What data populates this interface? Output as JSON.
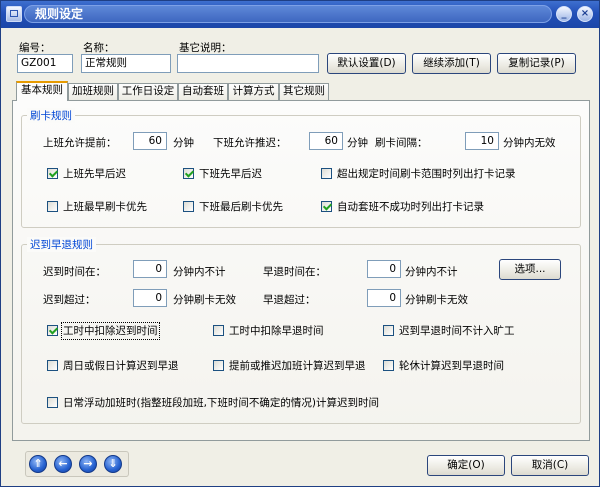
{
  "window": {
    "title": "规则设定"
  },
  "header": {
    "code_label": "编号：",
    "code_value": "GZ001",
    "name_label": "名称：",
    "name_value": "正常规则",
    "desc_label": "基它说明：",
    "desc_value": "",
    "btn_default": "默认设置(D)",
    "btn_add": "继续添加(T)",
    "btn_copy": "复制记录(P)"
  },
  "tabs": [
    "基本规则",
    "加班规则",
    "工作日设定",
    "自动套班",
    "计算方式",
    "其它规则"
  ],
  "active_tab": "基本规则",
  "swipe": {
    "group_title": "刷卡规则",
    "early_label": "上班允许提前：",
    "early_value": "60",
    "early_unit": "分钟",
    "late_label": "下班允许推迟：",
    "late_value": "60",
    "late_unit": "分钟",
    "interval_label": "刷卡间隔：",
    "interval_value": "10",
    "interval_unit": "分钟内无效",
    "checks": [
      {
        "label": "上班先早后迟",
        "checked": true
      },
      {
        "label": "下班先早后迟",
        "checked": true
      },
      {
        "label": "超出规定时间刷卡范围时列出打卡记录",
        "checked": false
      },
      {
        "label": "上班最早刷卡优先",
        "checked": false
      },
      {
        "label": "下班最后刷卡优先",
        "checked": false
      },
      {
        "label": "自动套班不成功时列出打卡记录",
        "checked": true
      }
    ]
  },
  "late": {
    "group_title": "迟到早退规则",
    "late_within_label": "迟到时间在：",
    "late_within_value": "0",
    "late_within_unit": "分钟内不计",
    "early_within_label": "早退时间在：",
    "early_within_value": "0",
    "early_within_unit": "分钟内不计",
    "options_btn": "选项...",
    "late_over_label": "迟到超过：",
    "late_over_value": "0",
    "late_over_unit": "分钟刷卡无效",
    "early_over_label": "早退超过：",
    "early_over_value": "0",
    "early_over_unit": "分钟刷卡无效",
    "checks": [
      {
        "label": "工时中扣除迟到时间",
        "checked": true
      },
      {
        "label": "工时中扣除早退时间",
        "checked": false
      },
      {
        "label": "迟到早退时间不计入旷工",
        "checked": false
      },
      {
        "label": "周日或假日计算迟到早退",
        "checked": false
      },
      {
        "label": "提前或推迟加班计算迟到早退",
        "checked": false
      },
      {
        "label": "轮休计算迟到早退时间",
        "checked": false
      },
      {
        "label": "日常浮动加班时(指整班段加班,下班时间不确定的情况)计算迟到时间",
        "checked": false
      }
    ]
  },
  "footer": {
    "ok": "确定(O)",
    "cancel": "取消(C)",
    "nav_icons": [
      "first-icon",
      "prev-icon",
      "next-icon",
      "last-icon"
    ]
  }
}
